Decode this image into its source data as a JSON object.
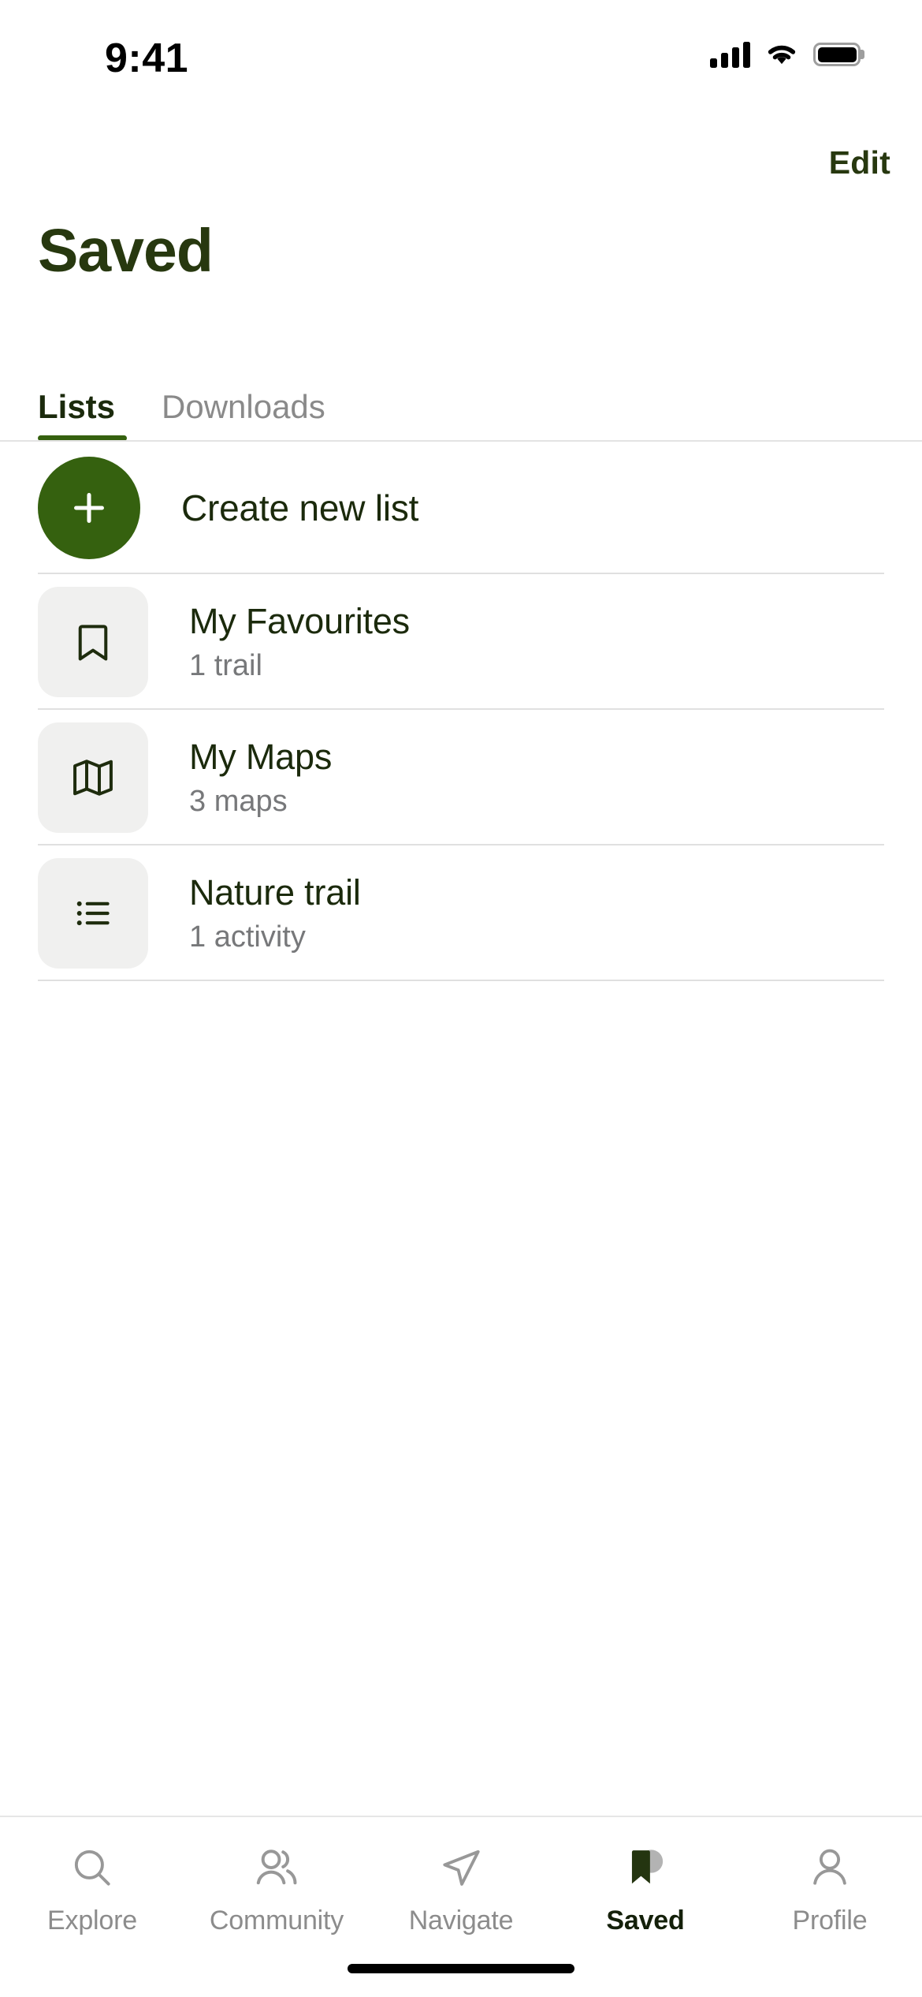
{
  "status_bar": {
    "time": "9:41",
    "cellular_icon": "cellular-bars-icon",
    "wifi_icon": "wifi-icon",
    "battery_icon": "battery-full-icon"
  },
  "nav": {
    "edit_label": "Edit"
  },
  "header": {
    "title": "Saved"
  },
  "segment_tabs": {
    "items": [
      {
        "label": "Lists",
        "active": true
      },
      {
        "label": "Downloads",
        "active": false
      }
    ],
    "active_underline_color": "#35610f"
  },
  "list": {
    "create": {
      "label": "Create new list",
      "icon": "plus-icon",
      "circle_color": "#35610f"
    },
    "items": [
      {
        "title": "My Favourites",
        "subtitle": "1 trail",
        "icon": "bookmark-icon"
      },
      {
        "title": "My Maps",
        "subtitle": "3 maps",
        "icon": "map-icon"
      },
      {
        "title": "Nature trail",
        "subtitle": "1 activity",
        "icon": "list-bullet-icon"
      }
    ]
  },
  "bottom_tabs": {
    "items": [
      {
        "label": "Explore",
        "icon": "search-icon",
        "active": false
      },
      {
        "label": "Community",
        "icon": "people-icon",
        "active": false
      },
      {
        "label": "Navigate",
        "icon": "navigate-icon",
        "active": false
      },
      {
        "label": "Saved",
        "icon": "bookmark-filled-icon",
        "active": true
      },
      {
        "label": "Profile",
        "icon": "person-icon",
        "active": false
      }
    ]
  },
  "colors": {
    "brand_dark_green": "#27380f",
    "brand_green": "#35610f",
    "text_primary": "#1b2a0c",
    "text_secondary": "#77787a",
    "tile_bg": "#f0f0ef",
    "divider": "#e0e0e0"
  }
}
